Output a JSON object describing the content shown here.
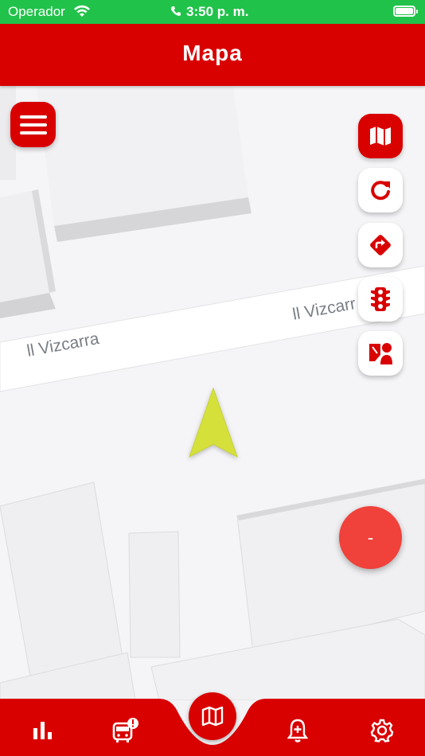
{
  "status_bar": {
    "carrier": "Operador",
    "time": "3:50 p. m."
  },
  "header": {
    "title": "Mapa"
  },
  "map": {
    "street_labels": [
      "ll Vizcarra",
      "ll Vizcarr"
    ]
  },
  "colors": {
    "brand_red": "#d90000",
    "status_green": "#21c24a",
    "fab_red": "#f0413a",
    "location_arrow": "#d6e03a"
  },
  "controls": {
    "menu": "menu-icon",
    "map_layers": "map-icon",
    "refresh": "refresh-icon",
    "directions": "directions-icon",
    "traffic": "traffic-light-icon",
    "report": "report-icon"
  },
  "fab": {
    "label": "-"
  },
  "tabbar": {
    "items": [
      {
        "name": "stats",
        "icon": "bar-chart-icon"
      },
      {
        "name": "bus-alert",
        "icon": "bus-alert-icon"
      },
      {
        "name": "map",
        "icon": "map-icon"
      },
      {
        "name": "notifications",
        "icon": "bell-plus-icon"
      },
      {
        "name": "settings",
        "icon": "gear-icon"
      }
    ]
  }
}
